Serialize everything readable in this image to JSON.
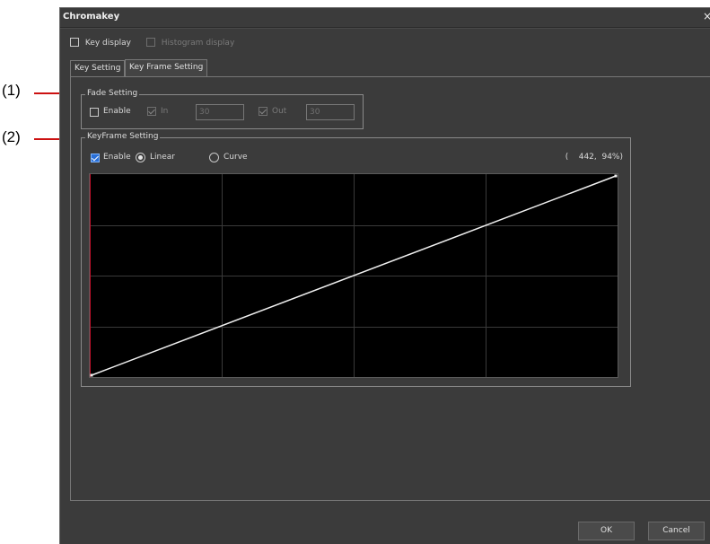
{
  "callouts": [
    "(1)",
    "(2)"
  ],
  "window": {
    "title": "Chromakey",
    "close_glyph": "×"
  },
  "top_options": {
    "key_display": {
      "label": "Key display",
      "checked": false
    },
    "histogram_display": {
      "label": "Histogram display",
      "checked": false,
      "enabled": false
    }
  },
  "tabs": [
    {
      "label": "Key Setting",
      "active": false
    },
    {
      "label": "Key Frame Setting",
      "active": true
    }
  ],
  "fade_setting": {
    "legend": "Fade Setting",
    "enable": {
      "label": "Enable",
      "checked": false
    },
    "in": {
      "label": "In",
      "checked": true,
      "value": "30"
    },
    "out": {
      "label": "Out",
      "checked": true,
      "value": "30"
    }
  },
  "keyframe_setting": {
    "legend": "KeyFrame Setting",
    "enable": {
      "label": "Enable",
      "checked": true
    },
    "mode": {
      "linear_label": "Linear",
      "curve_label": "Curve",
      "selected": "Linear"
    },
    "readout": "(    442,  94%)",
    "graph": {
      "grid_columns": 4,
      "grid_rows": 4,
      "line_start": [
        0,
        0
      ],
      "line_end": [
        1,
        1
      ],
      "line_color": "#f0f0f0",
      "grid_color": "#3a3a3a",
      "edge_color": "#c0102a"
    }
  },
  "buttons": {
    "ok": "OK",
    "cancel": "Cancel"
  },
  "colors": {
    "dialog_bg": "#3b3b3b",
    "graph_bg": "#000000",
    "callout_line": "#cc1111",
    "check_accent": "#2a6fd6"
  }
}
